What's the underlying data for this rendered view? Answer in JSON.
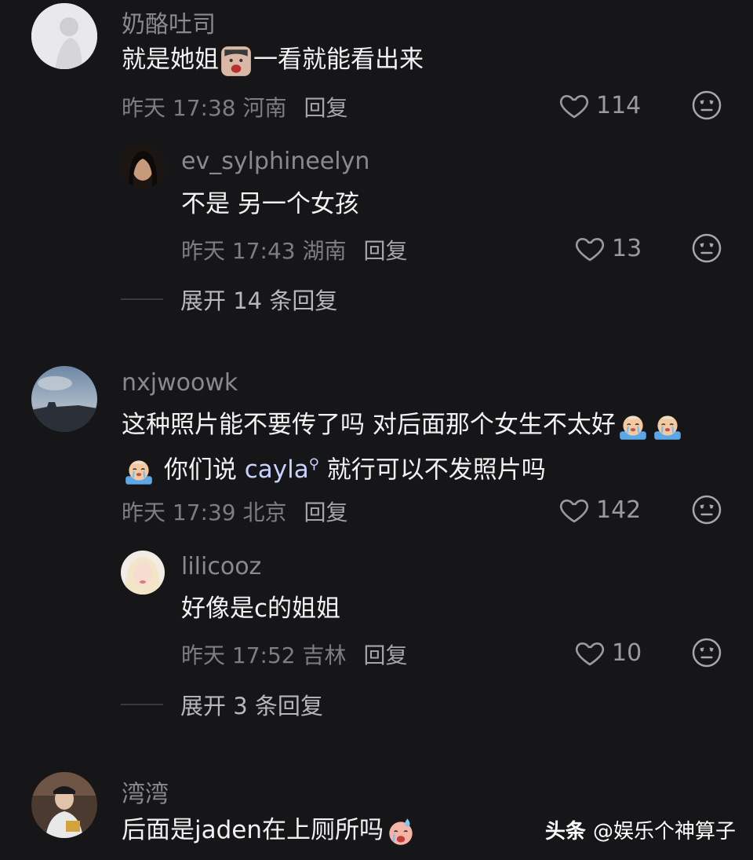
{
  "comments": [
    {
      "username": "奶酪吐司",
      "text_before": "就是她姐",
      "text_after": "一看就能看出来",
      "meta": "昨天 17:38 河南",
      "reply": "回复",
      "likes": "114",
      "replies": [
        {
          "username": "ev_sylphineelyn",
          "text": "不是 另一个女孩",
          "meta": "昨天 17:43 湖南",
          "reply": "回复",
          "likes": "13"
        }
      ],
      "expand": "展开 14 条回复"
    },
    {
      "username": "nxjwoowk",
      "line1": "这种照片能不要传了吗 对后面那个女生不太好",
      "line2_before": "你们说",
      "line2_term": "cayla",
      "line2_after": "就行可以不发照片吗",
      "meta": "昨天 17:39 北京",
      "reply": "回复",
      "likes": "142",
      "replies": [
        {
          "username": "lilicooz",
          "text": "好像是c的姐姐",
          "meta": "昨天 17:52 吉林",
          "reply": "回复",
          "likes": "10"
        }
      ],
      "expand": "展开 3 条回复"
    },
    {
      "username": "湾湾",
      "text": "后面是jaden在上厕所吗"
    }
  ],
  "watermark": {
    "brand": "头条",
    "handle": "@娱乐个神算子"
  }
}
